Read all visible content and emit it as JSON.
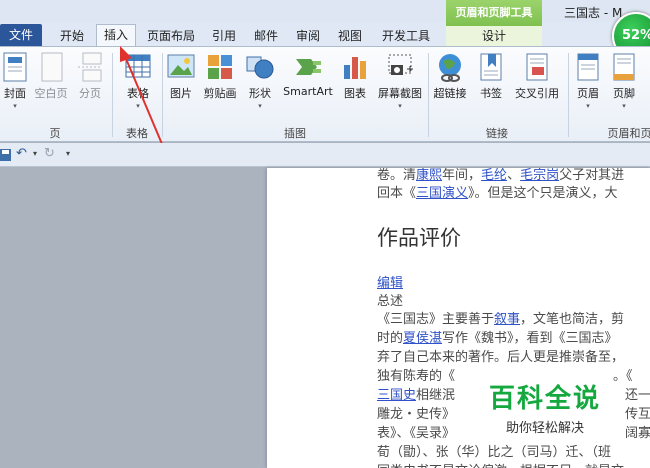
{
  "window": {
    "doc_title": "三国志 - M",
    "tool_group": "页眉和页脚工具",
    "progress": "52%"
  },
  "tabs": {
    "file": "文件",
    "home": "开始",
    "insert": "插入",
    "layout": "页面布局",
    "references": "引用",
    "mailings": "邮件",
    "review": "审阅",
    "view": "视图",
    "developer": "开发工具",
    "design": "设计"
  },
  "ribbon": {
    "pages": {
      "cover": "封面",
      "blank": "空白页",
      "break": "分页",
      "group": "页"
    },
    "tables": {
      "table": "表格",
      "group": "表格"
    },
    "illustrations": {
      "picture": "图片",
      "clipart": "剪贴画",
      "shapes": "形状",
      "smartart": "SmartArt",
      "chart": "图表",
      "screenshot": "屏幕截图",
      "group": "插图"
    },
    "links": {
      "hyperlink": "超链接",
      "bookmark": "书签",
      "crossref": "交叉引用",
      "group": "链接"
    },
    "header_footer": {
      "header": "页眉",
      "footer": "页脚",
      "group": "页眉和页脚"
    }
  },
  "document": {
    "line1_prefix": "卷。清",
    "line1_link1": "康熙",
    "line1_mid1": "年间，",
    "line1_link2": "毛纶",
    "line1_mid2": "、",
    "line1_link3": "毛宗岗",
    "line1_suffix": "父子对其进",
    "line2_prefix": "回本《",
    "line2_link": "三国演义",
    "line2_suffix": "》。但是这个只是演义，大",
    "heading": "作品评价",
    "edit_link": "编辑",
    "summary": "总述",
    "p1_prefix": "《三国志》主要善于",
    "p1_link": "叙事",
    "p1_suffix": "，文笔也简洁，剪",
    "p2_prefix": "时的",
    "p2_link": "夏侯湛",
    "p2_suffix": "写作《魏书》，看到《三国志》",
    "p3": "弃了自己本来的著作。后人更是推崇备至，",
    "p4_left": "独有陈寿的《",
    "p4_right": "。《",
    "p5_link": "三国史",
    "p5_mid": "相继泯",
    "p5_right": "还一",
    "p6_left": "雕龙・史传》",
    "p6_right": "传互",
    "p7_left": "表》、《吴录》",
    "p7_right": "阔寡",
    "p8": "荀（勖）、张（华）比之（司马）迁、（班",
    "p9": "同类史书不是文论偏激，根据不足，就是文"
  },
  "watermark": {
    "title": "百科全说",
    "subtitle": "助你轻松解决"
  }
}
